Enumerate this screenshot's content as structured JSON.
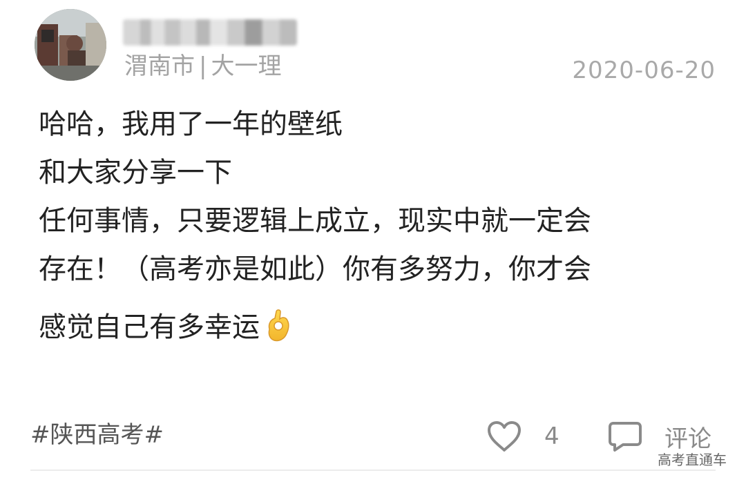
{
  "post": {
    "location": "渭南市",
    "separator": "|",
    "grade": "大一理",
    "date": "2020-06-20",
    "content_lines": [
      "哈哈，我用了一年的壁纸",
      "和大家分享一下",
      "任何事情，只要逻辑上成立，现实中就一定会",
      "存在！（高考亦是如此）你有多努力，你才会",
      "感觉自己有多幸运"
    ],
    "emoji": "ok-hand-icon",
    "tag": "#陕西高考#",
    "like_count": "4",
    "comment_label": "评论"
  },
  "watermark": "高考直通车",
  "colors": {
    "text_primary": "#222222",
    "text_meta": "#a3a3a3",
    "icon": "#8a8a8a",
    "emoji": "#f5c43a"
  }
}
